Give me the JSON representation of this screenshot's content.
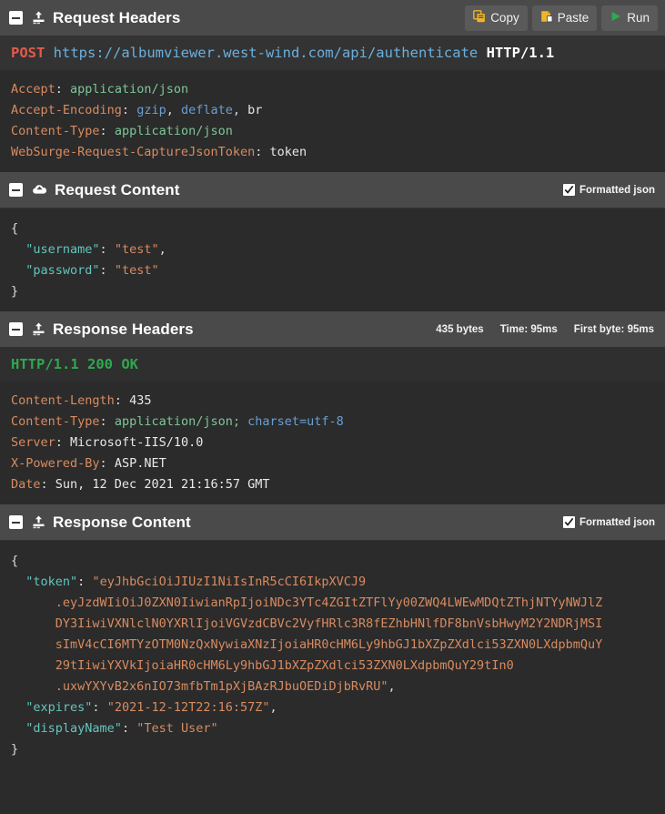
{
  "toolbar": {
    "copy_label": "Copy",
    "paste_label": "Paste",
    "run_label": "Run"
  },
  "sections": {
    "request_headers": {
      "title": "Request Headers",
      "icon": "upload-icon",
      "verb": "POST",
      "url": "https://albumviewer.west-wind.com/api/authenticate",
      "protocol": "HTTP/1.1",
      "headers": [
        {
          "key": "Accept",
          "value": "application/json",
          "value_type": "plain"
        },
        {
          "key": "Accept-Encoding",
          "value": "gzip, deflate, br",
          "value_type": "encoding"
        },
        {
          "key": "Content-Type",
          "value": "application/json",
          "value_type": "plain"
        },
        {
          "key": "WebSurge-Request-CaptureJsonToken",
          "value": "token",
          "value_type": "white"
        }
      ]
    },
    "request_content": {
      "title": "Request Content",
      "icon": "cloud-upload-icon",
      "formatted_label": "Formatted json",
      "formatted_checked": true,
      "lines": [
        {
          "indent": 0,
          "type": "punct",
          "text": "{"
        },
        {
          "indent": 1,
          "type": "pair",
          "key": "\"username\"",
          "value": "\"test\"",
          "trail": ","
        },
        {
          "indent": 1,
          "type": "pair",
          "key": "\"password\"",
          "value": "\"test\"",
          "trail": ""
        },
        {
          "indent": 0,
          "type": "punct",
          "text": "}"
        }
      ]
    },
    "response_headers": {
      "title": "Response Headers",
      "icon": "upload-icon",
      "metrics": [
        "435 bytes",
        "Time: 95ms",
        "First byte: 95ms"
      ],
      "status": "HTTP/1.1 200 OK",
      "headers": [
        {
          "key": "Content-Length",
          "value": "435",
          "value_type": "white"
        },
        {
          "key": "Content-Type",
          "value": "application/json;",
          "extra": "charset=utf-8",
          "value_type": "plain"
        },
        {
          "key": "Server",
          "value": "Microsoft-IIS/10.0",
          "value_type": "white"
        },
        {
          "key": "X-Powered-By",
          "value": "ASP.NET",
          "value_type": "white"
        },
        {
          "key": "Date",
          "value": "Sun, 12 Dec 2021 21:16:57 GMT",
          "value_type": "white"
        }
      ]
    },
    "response_content": {
      "title": "Response Content",
      "icon": "upload-icon",
      "formatted_label": "Formatted json",
      "formatted_checked": true,
      "lines": [
        {
          "indent": 0,
          "type": "punct",
          "text": "{"
        },
        {
          "indent": 1,
          "type": "pair_open",
          "key": "\"token\"",
          "value": "\"eyJhbGciOiJIUzI1NiIsInR5cCI6IkpXVCJ9"
        },
        {
          "indent": 3,
          "type": "str",
          "text": ".eyJzdWIiOiJ0ZXN0IiwianRpIjoiNDc3YTc4ZGItZTFlYy00ZWQ4LWEwMDQtZThjNTYyNWJlZ"
        },
        {
          "indent": 3,
          "type": "str",
          "text": "DY3IiwiVXNlclN0YXRlIjoiVGVzdCBVc2VyfHRlc3R8fEZhbHNlfDF8bnVsbHwyM2Y2NDRjMSI"
        },
        {
          "indent": 3,
          "type": "str",
          "text": "sImV4cCI6MTYzOTM0NzQxNywiaXNzIjoiaHR0cHM6Ly9hbGJ1bXZpZXdlci53ZXN0LXdpbmQuY"
        },
        {
          "indent": 3,
          "type": "str",
          "text": "29tIiwiYXVkIjoiaHR0cHM6Ly9hbGJ1bXZpZXdlci53ZXN0LXdpbmQuY29tIn0"
        },
        {
          "indent": 3,
          "type": "str_close",
          "text": ".uxwYXYvB2x6nIO73mfbTm1pXjBAzRJbuOEDiDjbRvRU\"",
          "trail": ","
        },
        {
          "indent": 1,
          "type": "pair",
          "key": "\"expires\"",
          "value": "\"2021-12-12T22:16:57Z\"",
          "trail": ","
        },
        {
          "indent": 1,
          "type": "pair",
          "key": "\"displayName\"",
          "value": "\"Test User\"",
          "trail": ""
        },
        {
          "indent": 0,
          "type": "punct",
          "text": "}"
        }
      ]
    }
  },
  "colors": {
    "background": "#2b2b2b",
    "header_bar": "#4a4a4a",
    "verb": "#e05c4b",
    "url": "#6ab0de",
    "header_key": "#d98b60",
    "header_value": "#7ec699",
    "status_ok": "#2fa84f",
    "json_key": "#63c5bd",
    "json_string": "#d98b60",
    "accent_gold": "#f0b429",
    "accent_green": "#2fa84f"
  }
}
